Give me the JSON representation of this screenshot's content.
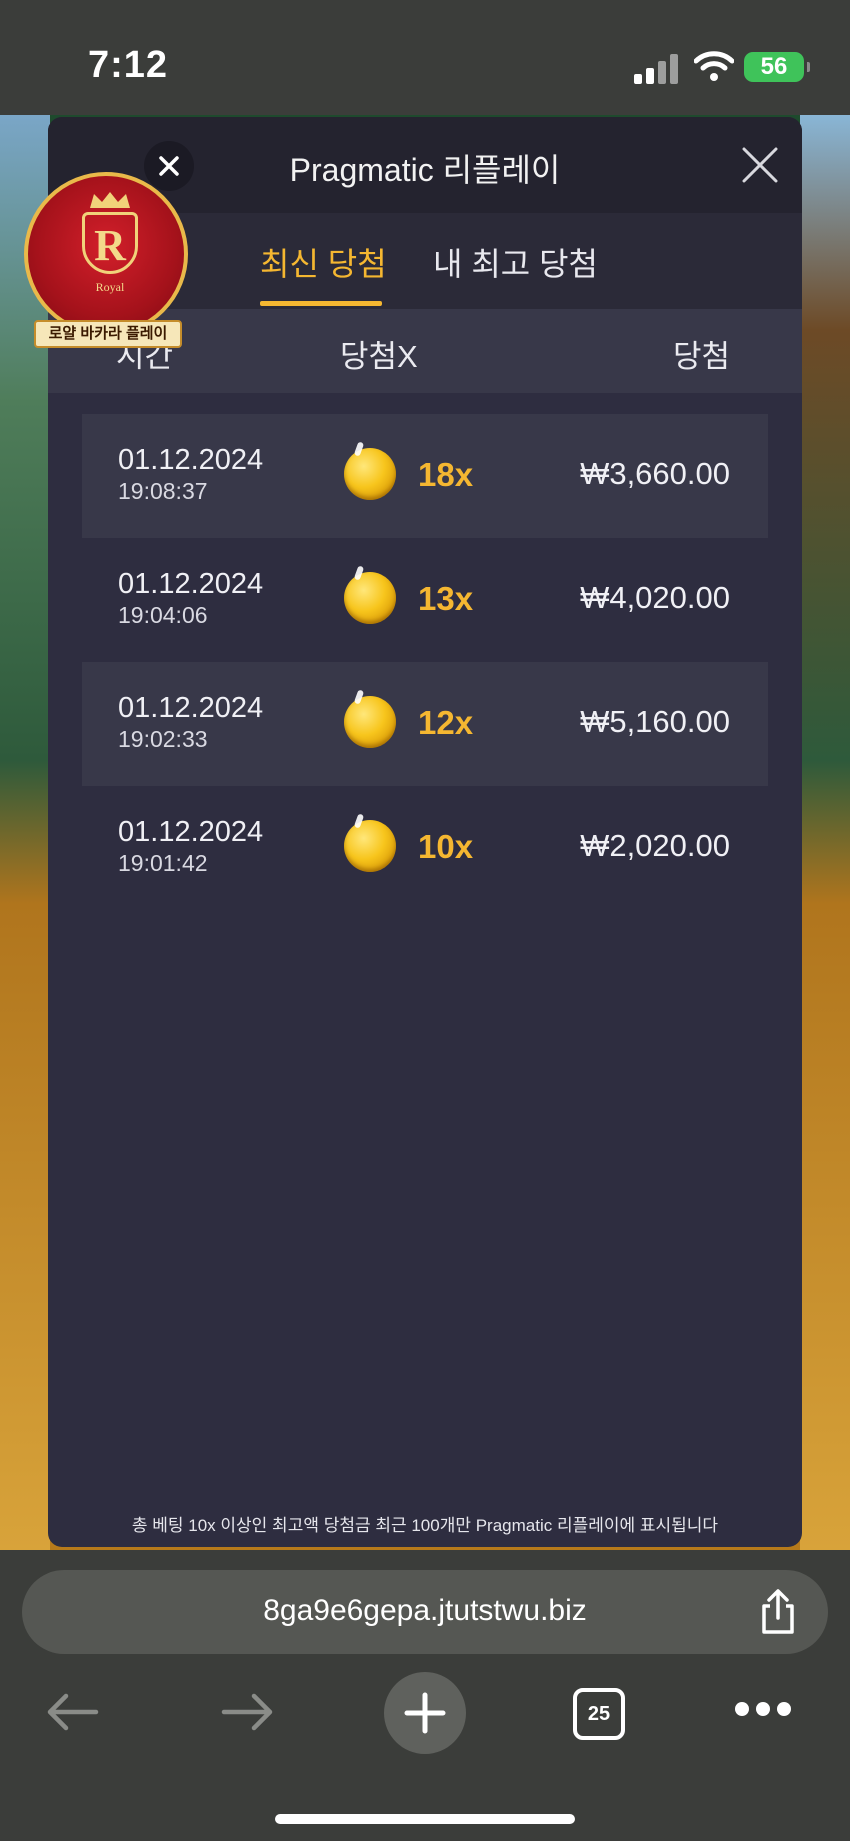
{
  "status_bar": {
    "time": "7:12",
    "battery": "56"
  },
  "modal": {
    "title": "Pragmatic 리플레이",
    "tabs": [
      {
        "label": "최신 당첨",
        "active": true
      },
      {
        "label": "내 최고 당첨",
        "active": false
      }
    ],
    "columns": {
      "time": "시간",
      "multiplier": "당첨X",
      "win": "당첨"
    },
    "rows": [
      {
        "date": "01.12.2024",
        "time": "19:08:37",
        "multiplier": "18x",
        "amount": "₩3,660.00"
      },
      {
        "date": "01.12.2024",
        "time": "19:04:06",
        "multiplier": "13x",
        "amount": "₩4,020.00"
      },
      {
        "date": "01.12.2024",
        "time": "19:02:33",
        "multiplier": "12x",
        "amount": "₩5,160.00"
      },
      {
        "date": "01.12.2024",
        "time": "19:01:42",
        "multiplier": "10x",
        "amount": "₩2,020.00"
      }
    ],
    "footer_note": "총 베팅 10x 이상인 최고액 당첨금 최근 100개만 Pragmatic 리플레이에 표시됩니다"
  },
  "logo": {
    "letter": "R",
    "ribbon": "Royal",
    "label": "로얄 바카라 플레이"
  },
  "browser": {
    "url": "8ga9e6gepa.jtutstwu.biz",
    "tab_count": "25"
  },
  "colors": {
    "accent": "#f5b731",
    "modal_bg": "#2e2d40",
    "row_shade": "#383849"
  }
}
